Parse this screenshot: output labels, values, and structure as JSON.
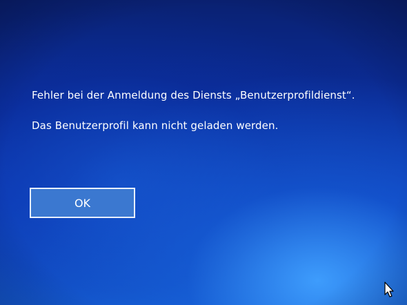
{
  "error_dialog": {
    "message_line_1": "Fehler bei der Anmeldung des Diensts „Benutzerprofildienst“.",
    "message_line_2": "Das Benutzerprofil kann nicht geladen werden.",
    "ok_label": "OK"
  },
  "cursor": {
    "icon": "mouse-pointer-icon"
  },
  "colors": {
    "background_dark": "#0a2172",
    "background_light": "#40a0ff",
    "button_fill": "#3b78d0",
    "button_border": "#e8f0ff",
    "text": "#ffffff"
  }
}
